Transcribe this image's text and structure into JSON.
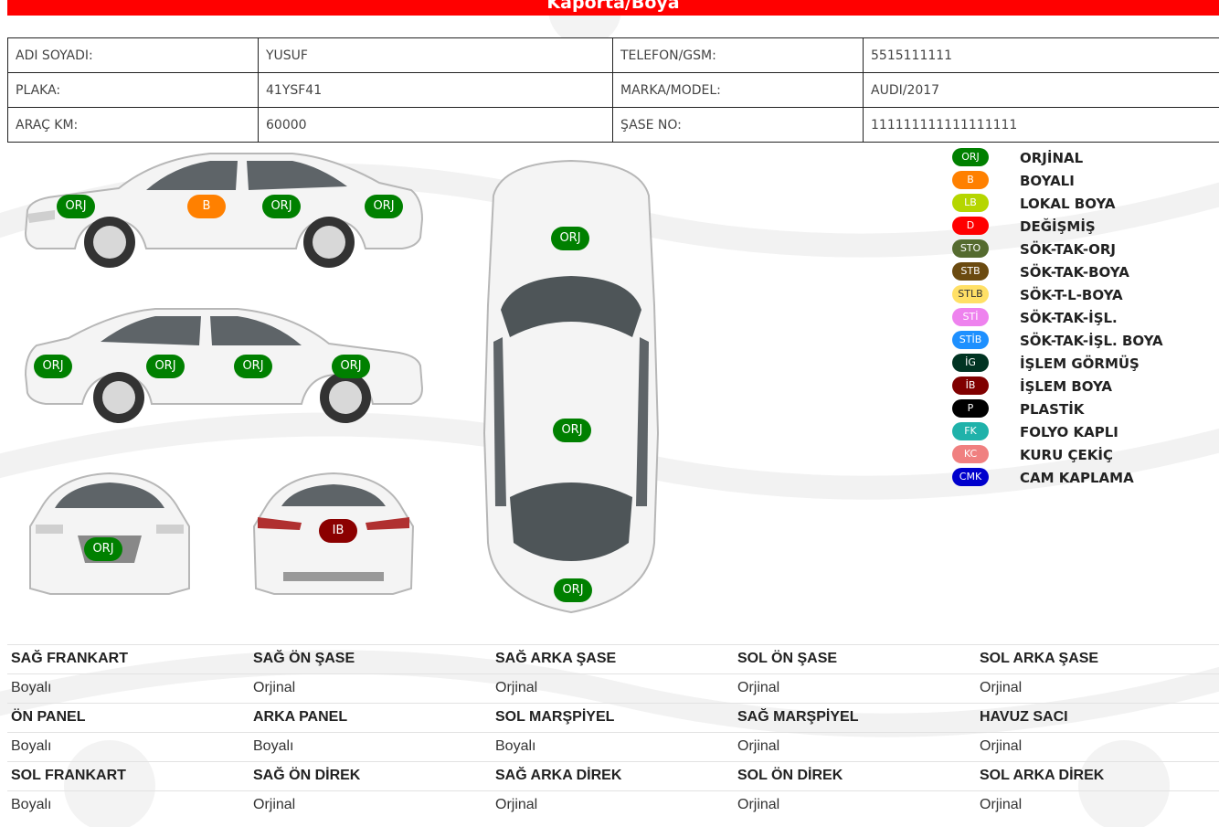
{
  "page_title": "Kaporta/Boya",
  "customer": {
    "rows": [
      {
        "label1": "ADI SOYADI:",
        "value1": "YUSUF",
        "label2": "TELEFON/GSM:",
        "value2": "5515111111"
      },
      {
        "label1": "PLAKA:",
        "value1": "41YSF41",
        "label2": "MARKA/MODEL:",
        "value2": "AUDI/2017"
      },
      {
        "label1": "ARAÇ KM:",
        "value1": "60000",
        "label2": "ŞASE NO:",
        "value2": "111111111111111111"
      }
    ]
  },
  "diagram": {
    "right_side": {
      "front_fender": "ORJ",
      "front_door": "B",
      "rear_door": "ORJ",
      "rear_fender": "ORJ"
    },
    "left_side": {
      "front_fender": "ORJ",
      "front_door": "ORJ",
      "rear_door": "ORJ",
      "rear_fender": "ORJ"
    },
    "front": {
      "bumper": "ORJ"
    },
    "rear": {
      "trunk": "IB"
    },
    "top": {
      "hood": "ORJ",
      "roof": "ORJ",
      "trunk": "ORJ"
    }
  },
  "legend": [
    {
      "code": "ORJ",
      "label": "ORJİNAL",
      "color": "#008000",
      "text_color": "#ffffff"
    },
    {
      "code": "B",
      "label": "BOYALI",
      "color": "#ff8000",
      "text_color": "#ffffff"
    },
    {
      "code": "LB",
      "label": "LOKAL BOYA",
      "color": "#b5d600",
      "text_color": "#ffffff"
    },
    {
      "code": "D",
      "label": "DEĞİŞMİŞ",
      "color": "#ff0000",
      "text_color": "#ffffff"
    },
    {
      "code": "STO",
      "label": "SÖK-TAK-ORJ",
      "color": "#556b2f",
      "text_color": "#ffffff"
    },
    {
      "code": "STB",
      "label": "SÖK-TAK-BOYA",
      "color": "#6b4a10",
      "text_color": "#ffffff"
    },
    {
      "code": "STLB",
      "label": "SÖK-T-L-BOYA",
      "color": "#ffe066",
      "text_color": "#333333"
    },
    {
      "code": "STİ",
      "label": "SÖK-TAK-İŞL.",
      "color": "#ee82ee",
      "text_color": "#ffffff"
    },
    {
      "code": "STİB",
      "label": "SÖK-TAK-İŞL. BOYA",
      "color": "#1e90ff",
      "text_color": "#ffffff"
    },
    {
      "code": "İG",
      "label": "İŞLEM GÖRMÜŞ",
      "color": "#003322",
      "text_color": "#ffffff"
    },
    {
      "code": "İB",
      "label": "İŞLEM BOYA",
      "color": "#800000",
      "text_color": "#ffffff"
    },
    {
      "code": "P",
      "label": "PLASTİK",
      "color": "#000000",
      "text_color": "#ffffff"
    },
    {
      "code": "FK",
      "label": "FOLYO KAPLI",
      "color": "#20b2aa",
      "text_color": "#ffffff"
    },
    {
      "code": "KC",
      "label": "KURU ÇEKİÇ",
      "color": "#f08080",
      "text_color": "#ffffff"
    },
    {
      "code": "CMK",
      "label": "CAM KAPLAMA",
      "color": "#0000cd",
      "text_color": "#ffffff"
    }
  ],
  "parts": {
    "rows": [
      {
        "headers": [
          "SAĞ FRANKART",
          "SAĞ ÖN ŞASE",
          "SAĞ ARKA ŞASE",
          "SOL ÖN ŞASE",
          "SOL ARKA ŞASE"
        ],
        "values": [
          "Boyalı",
          "Orjinal",
          "Orjinal",
          "Orjinal",
          "Orjinal"
        ]
      },
      {
        "headers": [
          "ÖN PANEL",
          "ARKA PANEL",
          "SOL MARŞPİYEL",
          "SAĞ MARŞPİYEL",
          "HAVUZ SACI"
        ],
        "values": [
          "Boyalı",
          "Boyalı",
          "Boyalı",
          "Orjinal",
          "Orjinal"
        ]
      },
      {
        "headers": [
          "SOL FRANKART",
          "SAĞ ÖN DİREK",
          "SAĞ ARKA DİREK",
          "SOL ÖN DİREK",
          "SOL ARKA DİREK"
        ],
        "values": [
          "Boyalı",
          "Orjinal",
          "Orjinal",
          "Orjinal",
          "Orjinal"
        ]
      }
    ]
  }
}
